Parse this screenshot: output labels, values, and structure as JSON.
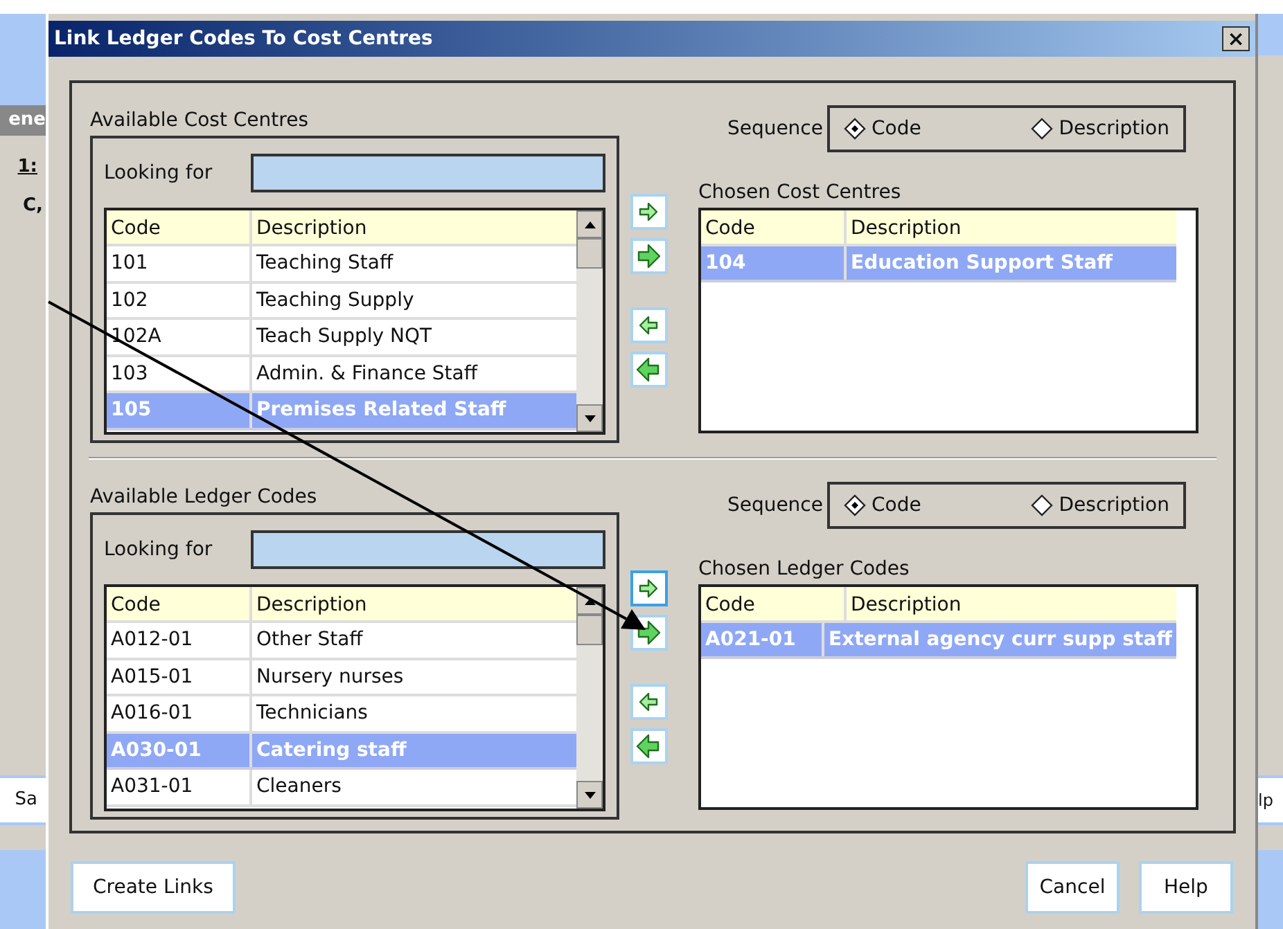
{
  "background": {
    "left_fragments": [
      "ene",
      "1:",
      "C,",
      "Sa"
    ],
    "right_fragments": [
      "lp"
    ]
  },
  "window": {
    "title": "Link Ledger Codes To Cost Centres",
    "close": "×"
  },
  "sections": [
    {
      "available": {
        "title": "Available Cost Centres",
        "search_label": "Looking for",
        "columns": [
          "Code",
          "Description"
        ],
        "rows": [
          {
            "code": "101",
            "description": "Teaching Staff",
            "selected": false
          },
          {
            "code": "102",
            "description": "Teaching Supply",
            "selected": false
          },
          {
            "code": "102A",
            "description": "Teach Supply NQT",
            "selected": false
          },
          {
            "code": "103",
            "description": "Admin. & Finance Staff",
            "selected": false
          },
          {
            "code": "105",
            "description": "Premises Related Staff",
            "selected": true
          }
        ]
      },
      "move_buttons": [
        {
          "kind": "right",
          "focused": false
        },
        {
          "kind": "right_all",
          "focused": false
        },
        {
          "kind": "left",
          "focused": false
        },
        {
          "kind": "left_all",
          "focused": false
        }
      ],
      "sequence": {
        "label": "Sequence",
        "options": [
          {
            "label": "Code",
            "selected": true
          },
          {
            "label": "Description",
            "selected": false
          }
        ]
      },
      "chosen": {
        "title": "Chosen Cost Centres",
        "columns": [
          "Code",
          "Description"
        ],
        "rows": [
          {
            "code": "104",
            "description": "Education Support Staff",
            "selected": true
          }
        ]
      }
    },
    {
      "available": {
        "title": "Available Ledger Codes",
        "search_label": "Looking for",
        "columns": [
          "Code",
          "Description"
        ],
        "rows": [
          {
            "code": "A012-01",
            "description": "Other Staff",
            "selected": false
          },
          {
            "code": "A015-01",
            "description": "Nursery nurses",
            "selected": false
          },
          {
            "code": "A016-01",
            "description": "Technicians",
            "selected": false
          },
          {
            "code": "A030-01",
            "description": "Catering staff",
            "selected": true
          },
          {
            "code": "A031-01",
            "description": "Cleaners",
            "selected": false
          }
        ]
      },
      "move_buttons": [
        {
          "kind": "right",
          "focused": true
        },
        {
          "kind": "right_all",
          "focused": false
        },
        {
          "kind": "left",
          "focused": false
        },
        {
          "kind": "left_all",
          "focused": false
        }
      ],
      "sequence": {
        "label": "Sequence",
        "options": [
          {
            "label": "Code",
            "selected": true
          },
          {
            "label": "Description",
            "selected": false
          }
        ]
      },
      "chosen": {
        "title": "Chosen Ledger Codes",
        "columns": [
          "Code",
          "Description"
        ],
        "rows": [
          {
            "code": "A021-01",
            "description": "External agency curr supp staff",
            "selected": true
          }
        ]
      }
    }
  ],
  "buttons": {
    "left": [
      "Create Links"
    ],
    "right": [
      "Cancel",
      "Help"
    ]
  }
}
